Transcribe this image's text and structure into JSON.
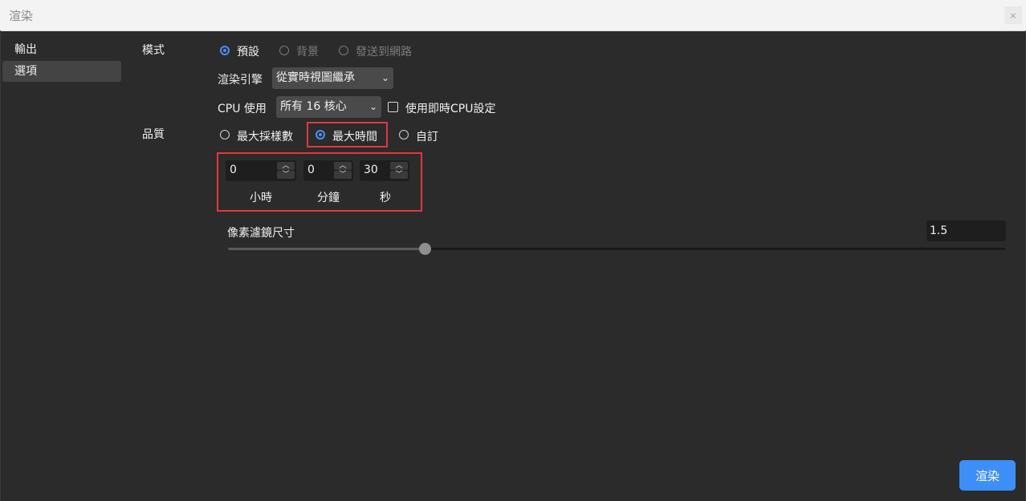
{
  "window": {
    "title": "渲染",
    "close_icon": "×"
  },
  "sidebar": {
    "items": [
      {
        "label": "輸出"
      },
      {
        "label": "選項",
        "active": true
      }
    ]
  },
  "mode": {
    "label": "模式",
    "options": [
      {
        "label": "預設",
        "checked": true,
        "disabled": false
      },
      {
        "label": "背景",
        "checked": false,
        "disabled": true
      },
      {
        "label": "發送到網路",
        "checked": false,
        "disabled": true
      }
    ]
  },
  "engine": {
    "label": "渲染引擎",
    "value": "從實時視圖繼承"
  },
  "cpu": {
    "label": "CPU 使用",
    "value": "所有 16 核心",
    "checkbox_label": "使用即時CPU設定",
    "checkbox_checked": false
  },
  "quality": {
    "label": "品質",
    "options": [
      {
        "label": "最大採樣數",
        "checked": false
      },
      {
        "label": "最大時間",
        "checked": true
      },
      {
        "label": "自訂",
        "checked": false
      }
    ]
  },
  "time": {
    "hours": {
      "value": "0",
      "label": "小時"
    },
    "minutes": {
      "value": "0",
      "label": "分鐘"
    },
    "seconds": {
      "value": "30",
      "label": "秒"
    }
  },
  "pixel_filter": {
    "label": "像素濾鏡尺寸",
    "value": "1.5",
    "slider_fraction": 0.25
  },
  "render_button": {
    "label": "渲染"
  },
  "colors": {
    "accent": "#3e8ef7",
    "highlight": "#e0383e",
    "background": "#2b2b2b"
  }
}
